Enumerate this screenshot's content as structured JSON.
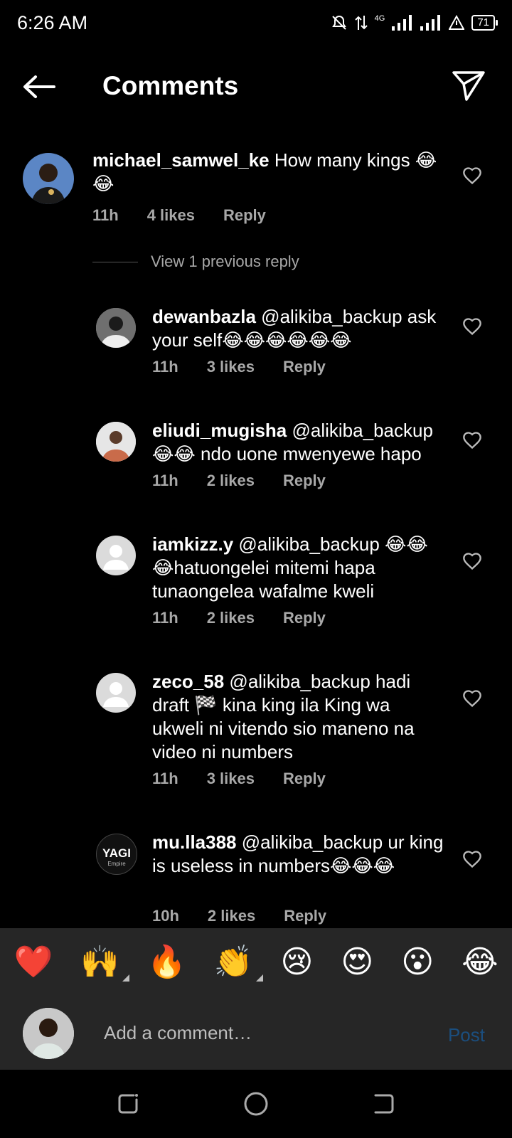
{
  "status_bar": {
    "time": "6:26 AM",
    "network": "4G",
    "battery": "71"
  },
  "header": {
    "title": "Comments"
  },
  "comments": [
    {
      "username": "michael_samwel_ke",
      "text": "How many kings 😂😂",
      "time": "11h",
      "likes": "4 likes",
      "reply_label": "Reply"
    },
    {
      "view_replies": "View 1 previous reply"
    },
    {
      "username": "dewanbazla",
      "text": "@alikiba_backup ask your self😂😂😂😂😂😂",
      "time": "11h",
      "likes": "3 likes",
      "reply_label": "Reply"
    },
    {
      "username": "eliudi_mugisha",
      "text": "@alikiba_backup 😂😂 ndo uone mwenyewe hapo",
      "time": "11h",
      "likes": "2 likes",
      "reply_label": "Reply"
    },
    {
      "username": "iamkizz.y",
      "text": "@alikiba_backup 😂😂😂hatuongelei mitemi hapa tunaongelea wafalme kweli",
      "time": "11h",
      "likes": "2 likes",
      "reply_label": "Reply"
    },
    {
      "username": "zeco_58",
      "text": "@alikiba_backup hadi draft 🏁 kina king ila King wa ukweli ni vitendo sio maneno na video ni numbers",
      "time": "11h",
      "likes": "3 likes",
      "reply_label": "Reply"
    },
    {
      "username": "mu.lla388",
      "text": "@alikiba_backup ur king is useless in numbers😂😂😂",
      "time": "10h",
      "likes": "2 likes",
      "reply_label": "Reply",
      "avatar_text": "YAGI",
      "avatar_subtext": "Empire"
    }
  ],
  "emoji_bar": [
    "❤️",
    "🙌",
    "🔥",
    "👏",
    "😢",
    "😍",
    "😮",
    "😂"
  ],
  "comment_bar": {
    "placeholder": "Add a comment…",
    "post_label": "Post"
  }
}
